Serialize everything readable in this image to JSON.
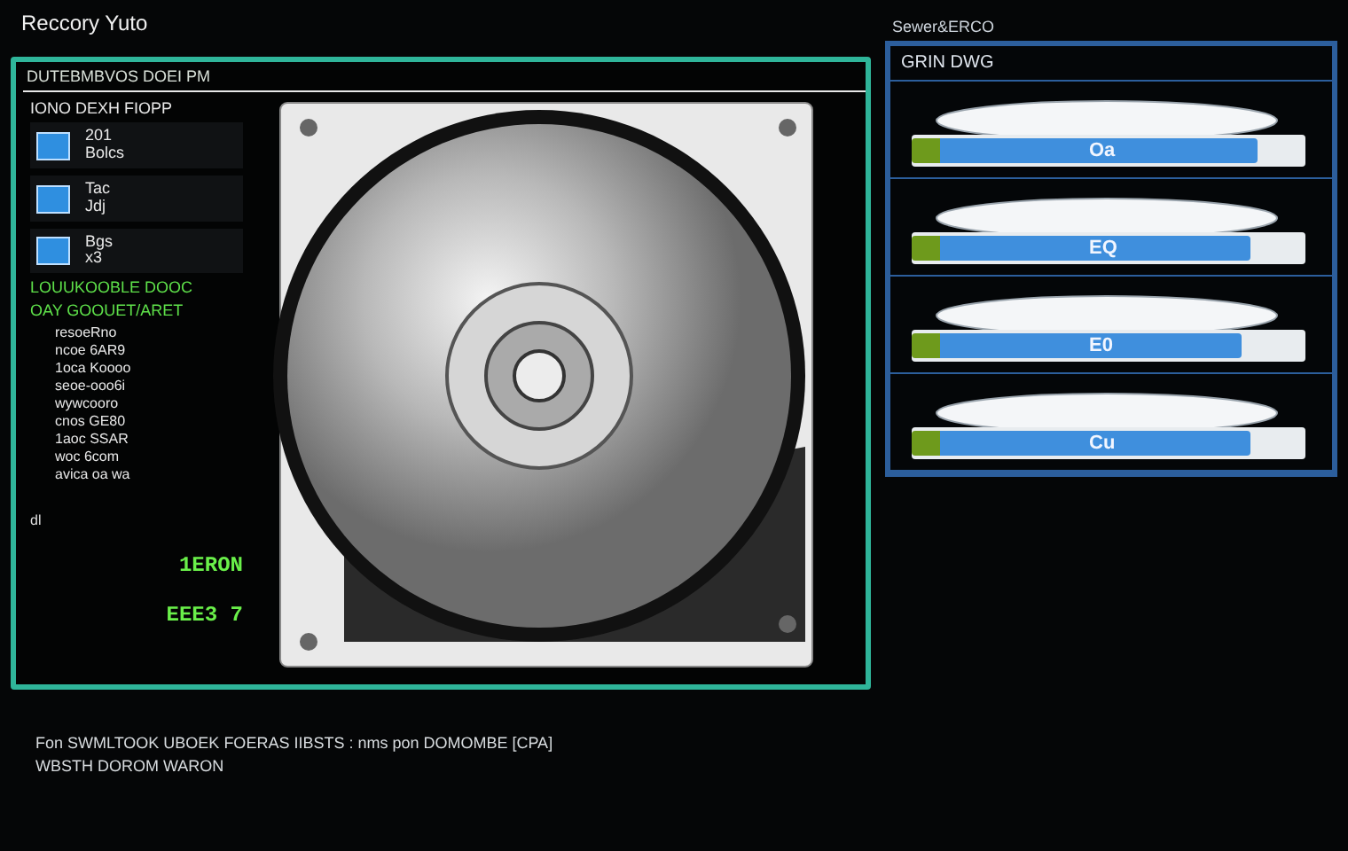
{
  "window": {
    "title": "Reccory Yuto"
  },
  "main_panel": {
    "header": "DUTEBMBVOS DOEI PM"
  },
  "file_list": {
    "heading": "IONO DEXH FIOPP",
    "items": [
      {
        "name": "201",
        "detail": "Bolcs"
      },
      {
        "name": "Tac",
        "detail": "Jdj"
      },
      {
        "name": "Bgs",
        "detail": "x3"
      }
    ]
  },
  "scan_status": {
    "title": "LOUUKOOBLE DOOC",
    "subtitle": "OAY GOOUET/ARET"
  },
  "sector_rows": [
    "resoeRno",
    "ncoe 6AR9",
    "1oca Koooo",
    "seoe-ooo6i",
    "wywcooro",
    "cnos GE80",
    "1aoc SSAR",
    "woc 6com",
    "avica oa wa"
  ],
  "readouts": {
    "label": "dl",
    "values": [
      "1ERON",
      "EEE3 7"
    ]
  },
  "drives_panel": {
    "caption": "Sewer&ERCO",
    "title": "GRIN DWG",
    "drives": [
      {
        "label": "Oa",
        "level": 0.88
      },
      {
        "label": "EQ",
        "level": 0.86
      },
      {
        "label": "E0",
        "level": 0.84
      },
      {
        "label": "Cu",
        "level": 0.86
      }
    ]
  },
  "status_bar": {
    "lines": [
      "Fon SWMLTOOK UBOEK FOERAS IIBSTS : nms pon DOMOMBE [CPA]",
      "WBSTH DOROM WARON"
    ]
  }
}
